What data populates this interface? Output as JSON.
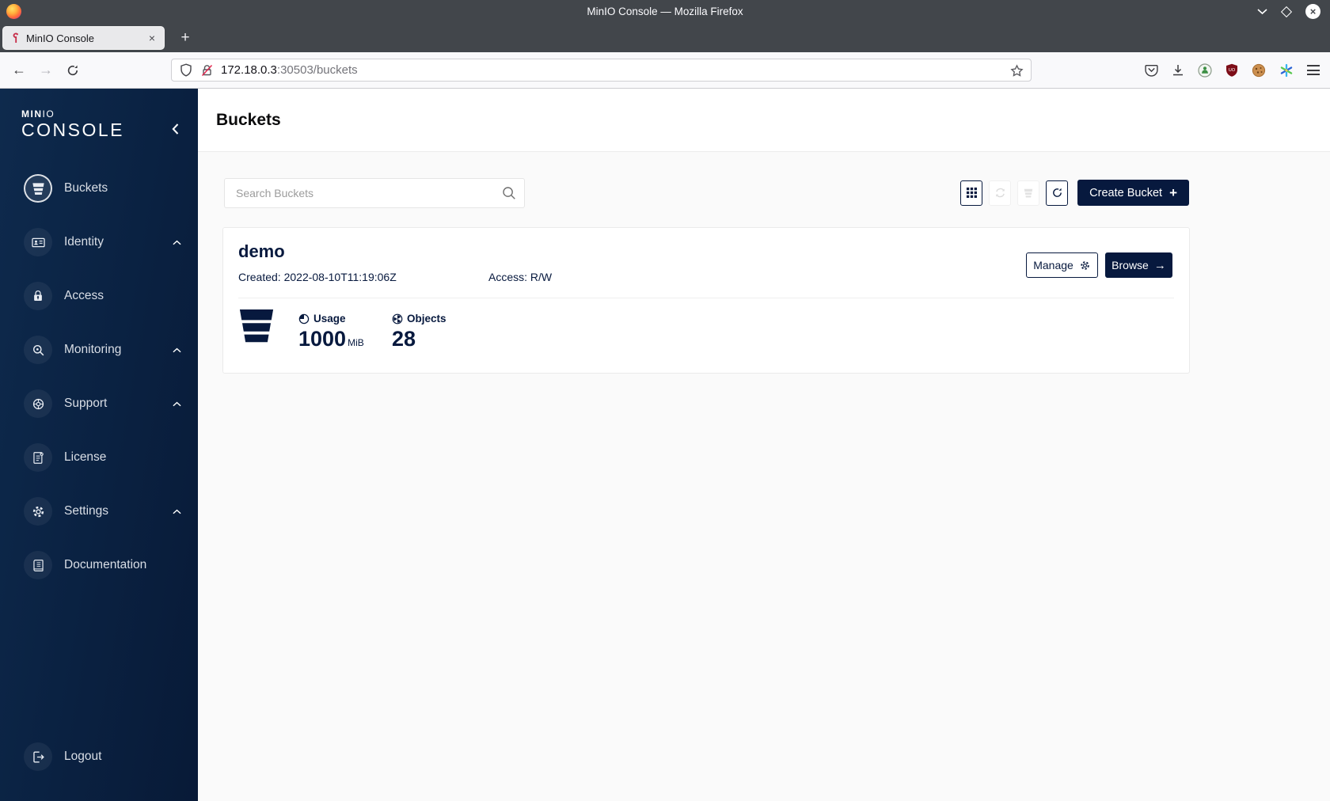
{
  "browser": {
    "window_title": "MinIO Console — Mozilla Firefox",
    "tab_title": "MinIO Console",
    "tab_close": "×",
    "new_tab_label": "+",
    "back_icon": "←",
    "forward_icon": "→",
    "url_host": "172.18.0.3",
    "url_rest": ":30503/buckets"
  },
  "sidebar": {
    "brand_min": "MIN",
    "brand_io": "IO",
    "brand_console": "CONSOLE",
    "items": [
      {
        "label": "Buckets"
      },
      {
        "label": "Identity"
      },
      {
        "label": "Access"
      },
      {
        "label": "Monitoring"
      },
      {
        "label": "Support"
      },
      {
        "label": "License"
      },
      {
        "label": "Settings"
      },
      {
        "label": "Documentation"
      }
    ],
    "logout_label": "Logout"
  },
  "header": {
    "title": "Buckets"
  },
  "toolbar": {
    "search_placeholder": "Search Buckets",
    "create_label": "Create Bucket",
    "create_plus": "+"
  },
  "bucket": {
    "name": "demo",
    "created": "Created: 2022-08-10T11:19:06Z",
    "access": "Access: R/W",
    "usage_label": "Usage",
    "usage_value": "1000",
    "usage_unit": "MiB",
    "objects_label": "Objects",
    "objects_value": "28",
    "manage_label": "Manage",
    "browse_label": "Browse",
    "browse_arrow": "→"
  },
  "colors": {
    "accent_navy": "#07193E",
    "sidebar_gradient_start": "#0e2a4d",
    "sidebar_gradient_end": "#081a37",
    "brand_red": "#C72C48",
    "titlebar_gray": "#42464b",
    "content_bg": "#fafafa"
  }
}
